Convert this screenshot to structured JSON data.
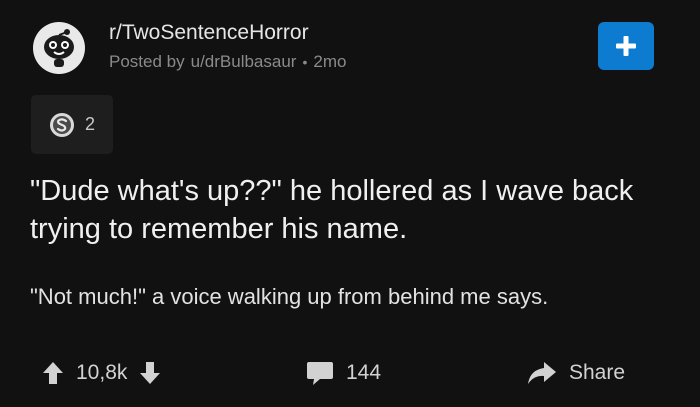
{
  "header": {
    "subreddit": "r/TwoSentenceHorror",
    "posted_by_prefix": "Posted by",
    "username": "u/drBulbasaur",
    "separator": "•",
    "age": "2mo",
    "avatar_icon": "snoo-avatar-icon",
    "join_icon": "plus-icon"
  },
  "award": {
    "icon": "silver-award-icon",
    "count": "2"
  },
  "post": {
    "title": "\"Dude what's up??\" he hollered as I wave back trying to remember his name.",
    "body": "\"Not much!\" a voice walking up from behind me says."
  },
  "actions": {
    "vote_count": "10,8k",
    "comment_count": "144",
    "share_label": "Share"
  },
  "colors": {
    "background": "#111112",
    "accent": "#0d7bd0",
    "chip": "#1e1e1f",
    "muted_text": "#8a8a8d"
  }
}
